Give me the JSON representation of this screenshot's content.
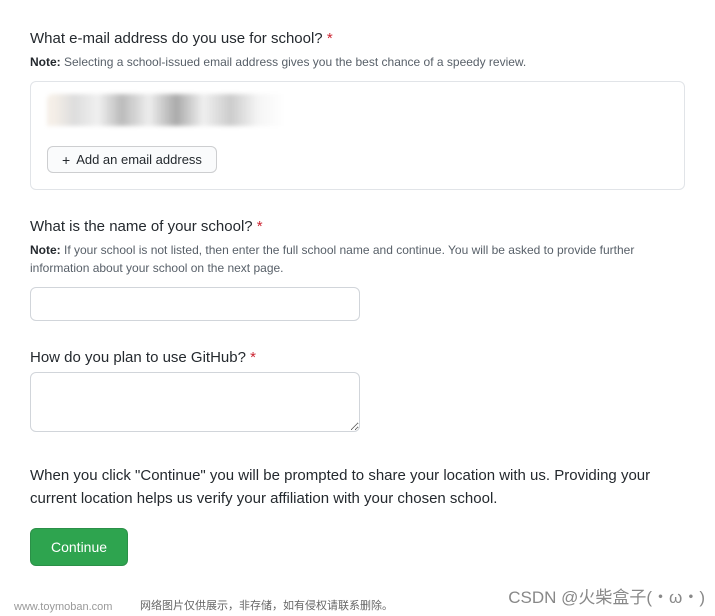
{
  "email_section": {
    "label": "What e-mail address do you use for school?",
    "note_prefix": "Note:",
    "note_text": " Selecting a school-issued email address gives you the best chance of a speedy review.",
    "add_button_label": "Add an email address"
  },
  "school_section": {
    "label": "What is the name of your school?",
    "note_prefix": "Note:",
    "note_text": " If your school is not listed, then enter the full school name and continue. You will be asked to provide further information about your school on the next page.",
    "value": ""
  },
  "plan_section": {
    "label": "How do you plan to use GitHub?",
    "value": ""
  },
  "location_notice": "When you click \"Continue\" you will be prompted to share your location with us. Providing your current location helps us verify your affiliation with your chosen school.",
  "continue_label": "Continue",
  "required_mark": "*",
  "watermark": {
    "site": "www.toymoban.com",
    "notice": "网络图片仅供展示，非存储，如有侵权请联系删除。",
    "author": "CSDN @火柴盒子(・ω・)"
  }
}
